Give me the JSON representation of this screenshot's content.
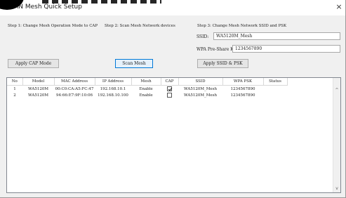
{
  "window": {
    "title": "WLAN Mesh Quick Setup",
    "close_label": "×"
  },
  "steps": {
    "step1": "Step 1: Change Mesh Operation Mode to CAP",
    "step2": "Step 2: Scan Mesh Network devices",
    "step3": "Step 3: Change Mesh Network SSID and PSK"
  },
  "form": {
    "ssid_label": "SSID:",
    "ssid_value": "WA5120M_Mesh",
    "psk_label": "WPA Pre-Share Key:",
    "psk_value": "1234567890"
  },
  "buttons": {
    "apply_cap": "Apply CAP Mode",
    "scan_mesh": "Scan Mesh",
    "apply_ssid_psk": "Apply SSID & PSK"
  },
  "table": {
    "columns": [
      "No",
      "Model",
      "MAC Address",
      "IP Address",
      "Mesh",
      "CAP",
      "SSID",
      "WPA PSK",
      "Status"
    ],
    "rows": [
      {
        "no": "1",
        "model": "WA5120M",
        "mac": "00:C0:CA:A5:FC:47",
        "ip": "192.168.10.1",
        "mesh": "Enable",
        "cap": true,
        "ssid": "WA5120M_Mesh",
        "psk": "1234567890",
        "status": ""
      },
      {
        "no": "2",
        "model": "WA5120M",
        "mac": "94:66:E7:9F:10:06",
        "ip": "192.168.10.100",
        "mesh": "Enable",
        "cap": false,
        "ssid": "WA5120M_Mesh",
        "psk": "1234567890",
        "status": ""
      }
    ]
  },
  "scrollbar": {
    "up_icon": "^",
    "down_icon": "v"
  }
}
